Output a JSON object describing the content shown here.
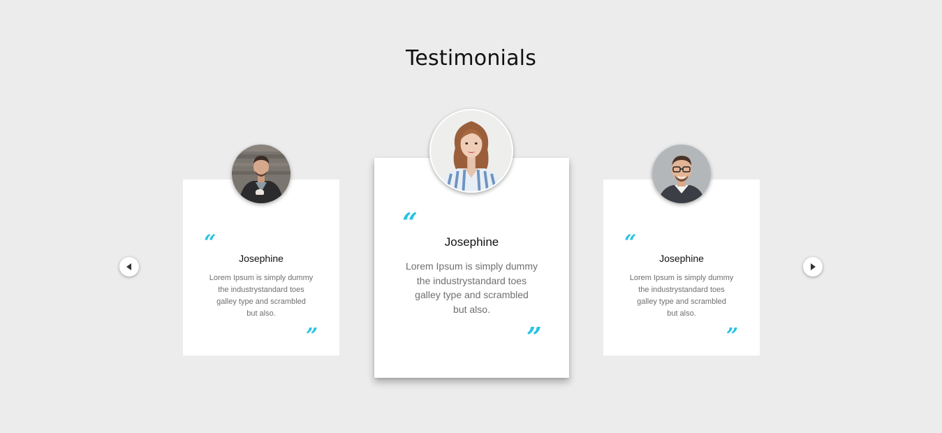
{
  "section": {
    "title": "Testimonials"
  },
  "testimonials": [
    {
      "name": "Josephine",
      "text_lines": [
        "Lorem Ipsum is simply dummy",
        "the industrystandard toes",
        "galley type and scrambled",
        "but also."
      ],
      "quote_open": "“",
      "quote_close": "”",
      "avatar": "man-with-coffee-avatar"
    },
    {
      "name": "Josephine",
      "text_lines": [
        "Lorem Ipsum is simply dummy",
        "the industrystandard toes",
        "galley type and scrambled",
        "but also."
      ],
      "quote_open": "“",
      "quote_close": "”",
      "avatar": "woman-in-striped-shirt-avatar"
    },
    {
      "name": "Josephine",
      "text_lines": [
        "Lorem Ipsum is simply dummy",
        "the industrystandard toes",
        "galley type and scrambled",
        "but also."
      ],
      "quote_open": "“",
      "quote_close": "”",
      "avatar": "man-with-glasses-avatar"
    }
  ],
  "navigation": {
    "prev_icon": "chevron-left-icon",
    "next_icon": "chevron-right-icon"
  },
  "colors": {
    "background": "#ececec",
    "card": "#ffffff",
    "accent_quote": "#29c3e0",
    "name_text": "#111111",
    "body_text": "#6f6f6f"
  }
}
